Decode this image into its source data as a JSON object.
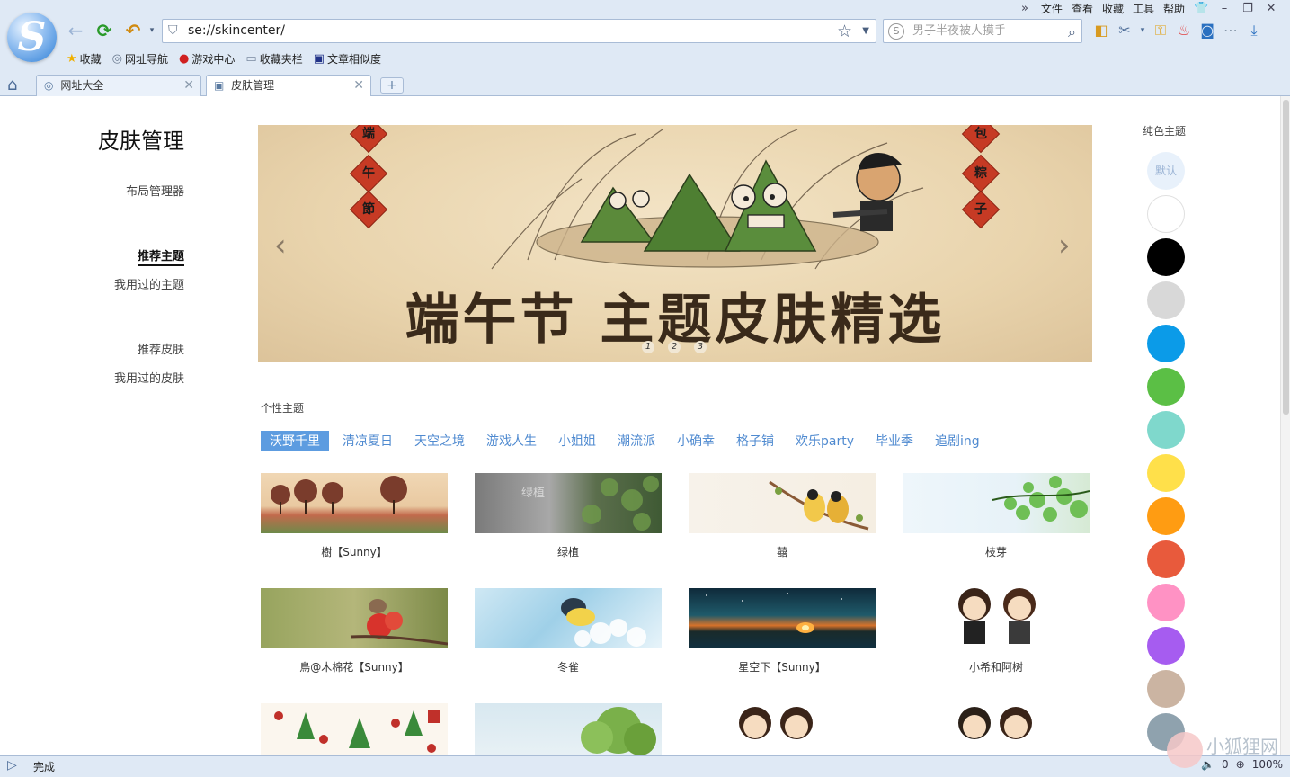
{
  "browser": {
    "menu": [
      "文件",
      "查看",
      "收藏",
      "工具",
      "帮助"
    ],
    "address": "se://skincenter/",
    "search_placeholder": "男子半夜被人摸手",
    "bookmarks": [
      {
        "label": "收藏",
        "icon": "star-icon"
      },
      {
        "label": "网址导航",
        "icon": "globe-icon"
      },
      {
        "label": "游戏中心",
        "icon": "game-icon"
      },
      {
        "label": "收藏夹栏",
        "icon": "folder-icon"
      },
      {
        "label": "文章相似度",
        "icon": "doc-icon"
      }
    ],
    "tabs": [
      {
        "label": "网址大全",
        "active": false
      },
      {
        "label": "皮肤管理",
        "active": true
      }
    ],
    "status_text": "完成",
    "zoom": "100%",
    "download_count": "0"
  },
  "sidebar": {
    "title": "皮肤管理",
    "layout_manager": "布局管理器",
    "recommended_themes": "推荐主题",
    "used_themes": "我用过的主题",
    "recommended_skins": "推荐皮肤",
    "used_skins": "我用过的皮肤"
  },
  "banner": {
    "headline": "端午节  主题皮肤精选",
    "seals_left": [
      "端",
      "午",
      "節"
    ],
    "seals_right": [
      "包",
      "粽",
      "子"
    ],
    "pages": [
      "1",
      "2",
      "3"
    ]
  },
  "themes": {
    "section_label": "个性主题",
    "categories": [
      "沃野千里",
      "清凉夏日",
      "天空之境",
      "游戏人生",
      "小姐姐",
      "潮流派",
      "小确幸",
      "格子铺",
      "欢乐party",
      "毕业季",
      "追剧ing"
    ],
    "active_category": 0,
    "cards": [
      {
        "caption": "樹【Sunny】"
      },
      {
        "caption": "绿植"
      },
      {
        "caption": "囍"
      },
      {
        "caption": "枝芽"
      },
      {
        "caption": "鳥@木棉花【Sunny】"
      },
      {
        "caption": "冬雀"
      },
      {
        "caption": "星空下【Sunny】"
      },
      {
        "caption": "小希和阿树"
      },
      {
        "caption": ""
      },
      {
        "caption": ""
      },
      {
        "caption": ""
      },
      {
        "caption": ""
      }
    ]
  },
  "solid_themes": {
    "title": "纯色主题",
    "default_label": "默认",
    "colors": [
      "#e8f1fb",
      "#ffffff",
      "#000000",
      "#d8d8d8",
      "#0b9be8",
      "#5bbf45",
      "#7fd8cc",
      "#ffe04a",
      "#ff9c12",
      "#e85a3c",
      "#ff92c4",
      "#a65cf0",
      "#cbb4a2",
      "#8fa2ae"
    ]
  },
  "watermark": "小狐狸网"
}
